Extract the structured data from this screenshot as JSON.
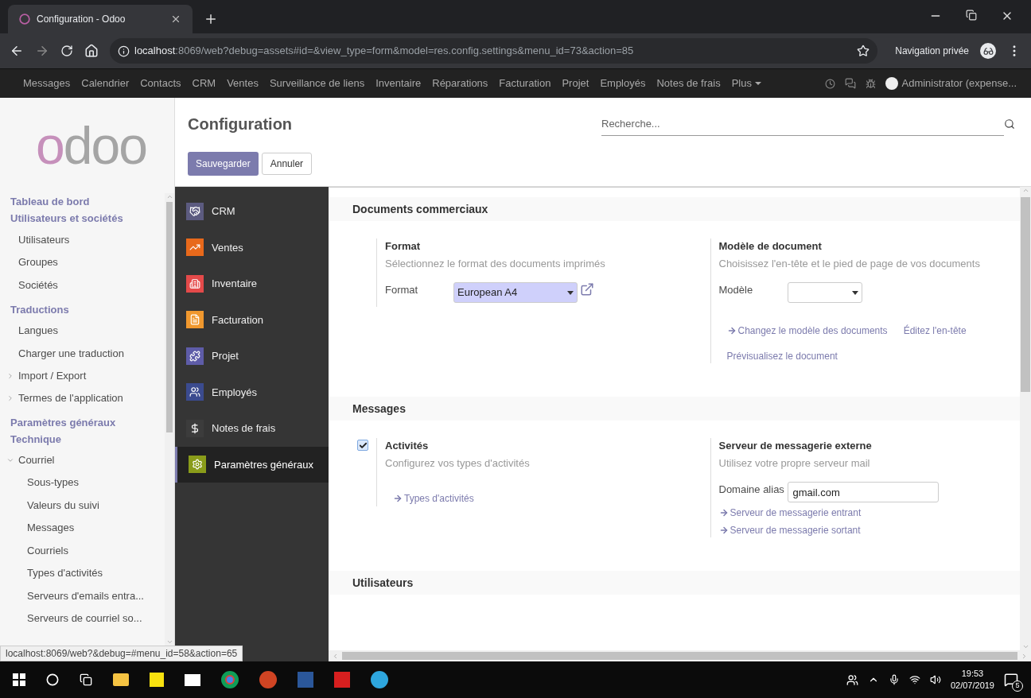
{
  "browser": {
    "tab_title": "Configuration - Odoo",
    "url_host": "localhost",
    "url_rest": ":8069/web?debug=assets#id=&view_type=form&model=res.config.settings&menu_id=73&action=85",
    "private_label": "Navigation privée"
  },
  "top_nav": {
    "items": [
      "Messages",
      "Calendrier",
      "Contacts",
      "CRM",
      "Ventes",
      "Surveillance de liens",
      "Inventaire",
      "Réparations",
      "Facturation",
      "Projet",
      "Employés",
      "Notes de frais"
    ],
    "more": "Plus",
    "user": "Administrator (expense..."
  },
  "sidebar": {
    "logo": "odoo",
    "menu": [
      {
        "label": "Tableau de bord",
        "kind": "section"
      },
      {
        "label": "Utilisateurs et sociétés",
        "kind": "section",
        "children": [
          {
            "label": "Utilisateurs",
            "kind": "leaf"
          },
          {
            "label": "Groupes",
            "kind": "leaf"
          },
          {
            "label": "Sociétés",
            "kind": "leaf"
          }
        ]
      },
      {
        "label": "Traductions",
        "kind": "section",
        "children": [
          {
            "label": "Langues",
            "kind": "leaf"
          },
          {
            "label": "Charger une traduction",
            "kind": "leaf"
          },
          {
            "label": "Import / Export",
            "kind": "folder",
            "expanded": false
          },
          {
            "label": "Termes de l'application",
            "kind": "folder",
            "expanded": false
          }
        ]
      },
      {
        "label": "Paramètres généraux",
        "kind": "section"
      },
      {
        "label": "Technique",
        "kind": "section",
        "children": [
          {
            "label": "Courriel",
            "kind": "folder",
            "expanded": true,
            "children": [
              {
                "label": "Sous-types",
                "kind": "leaf"
              },
              {
                "label": "Valeurs du suivi",
                "kind": "leaf"
              },
              {
                "label": "Messages",
                "kind": "leaf"
              },
              {
                "label": "Courriels",
                "kind": "leaf"
              },
              {
                "label": "Types d'activités",
                "kind": "leaf"
              },
              {
                "label": "Serveurs d'emails entra...",
                "kind": "leaf"
              },
              {
                "label": "Serveurs de courriel so...",
                "kind": "leaf"
              }
            ]
          }
        ]
      }
    ]
  },
  "control_panel": {
    "title": "Configuration",
    "buttons": [
      {
        "label": "Sauvegarder",
        "kind": "primary"
      },
      {
        "label": "Annuler",
        "kind": "secondary"
      }
    ],
    "search": {
      "placeholder": "Recherche..."
    }
  },
  "apps": [
    {
      "label": "CRM",
      "kind": "handshake",
      "color": "#5c5b80",
      "selected": false
    },
    {
      "label": "Ventes",
      "kind": "chart",
      "color": "#e8691b",
      "selected": false
    },
    {
      "label": "Inventaire",
      "kind": "box",
      "color": "#e44a4a",
      "selected": false
    },
    {
      "label": "Facturation",
      "kind": "document",
      "color": "#f0982e",
      "selected": false
    },
    {
      "label": "Projet",
      "kind": "puzzle",
      "color": "#5e5ca8",
      "selected": false
    },
    {
      "label": "Employés",
      "kind": "people",
      "color": "#3b4b8f",
      "selected": false
    },
    {
      "label": "Notes de frais",
      "kind": "dollar",
      "color": "#3c3c3c",
      "selected": false
    },
    {
      "label": "Paramètres généraux",
      "kind": "gear",
      "color": "#8a9c1a",
      "selected": true
    }
  ],
  "sections": [
    {
      "title": "Documents commerciaux",
      "settings": [
        {
          "title": "Format",
          "description": "Sélectionnez le format des documents imprimés",
          "fields": [
            {
              "label": "Format",
              "kind": "select",
              "value": "European A4",
              "external": true
            }
          ]
        },
        {
          "title": "Modèle de document",
          "description": "Choisissez l'en-tête et le pied de page de vos documents",
          "fields": [
            {
              "label": "Modèle",
              "kind": "select",
              "external": false
            }
          ],
          "link_rows": [
            [
              {
                "label": "Changez le modèle des documents",
                "arrow": true
              },
              {
                "label": "Éditez l'en-tête",
                "arrow": false
              }
            ],
            [
              {
                "label": "Prévisualisez le document",
                "arrow": false
              }
            ]
          ]
        }
      ]
    },
    {
      "title": "Messages",
      "settings": [
        {
          "title": "Activités",
          "description": "Configurez vos types d'activités",
          "checkbox": {
            "checked": true
          },
          "link_rows": [
            [
              {
                "label": "Types d'activités",
                "arrow": true
              }
            ]
          ]
        },
        {
          "title": "Serveur de messagerie externe",
          "description": "Utilisez votre propre serveur mail",
          "fields": [
            {
              "label": "Domaine alias",
              "kind": "input",
              "value": "gmail.com",
              "external": false
            }
          ],
          "link_rows": [
            [
              {
                "label": "Serveur de messagerie entrant",
                "arrow": true
              }
            ],
            [
              {
                "label": "Serveur de messagerie sortant",
                "arrow": true
              }
            ]
          ]
        }
      ]
    },
    {
      "title": "Utilisateurs"
    }
  ],
  "status_url": "localhost:8069/web?&debug=#menu_id=58&action=65",
  "taskbar": {
    "time": "19:53",
    "date": "02/07/2019",
    "notifications": "5"
  }
}
